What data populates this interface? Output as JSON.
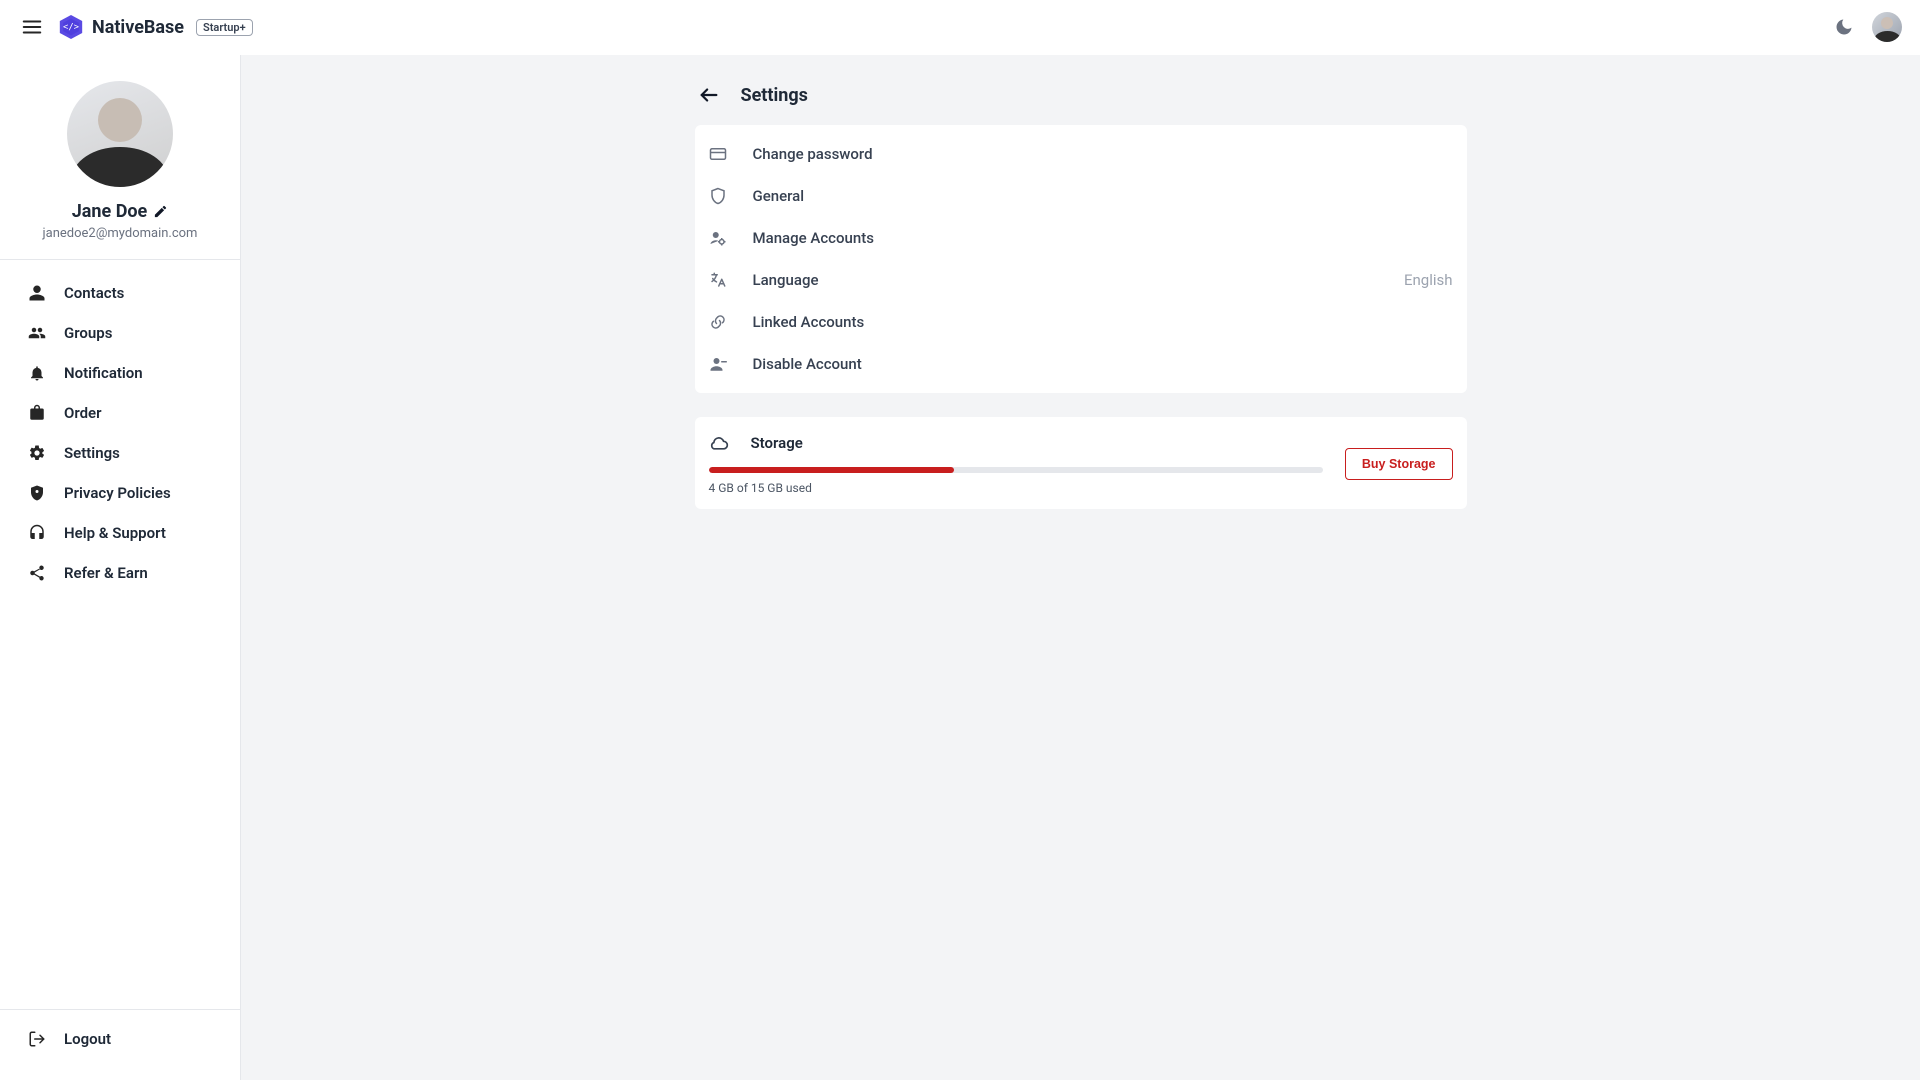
{
  "colors": {
    "accent_red": "#c81e1e"
  },
  "header": {
    "brand_name": "NativeBase",
    "plan_chip": "Startup+"
  },
  "sidebar": {
    "user": {
      "name": "Jane Doe",
      "email": "janedoe2@mydomain.com"
    },
    "items": [
      {
        "label": "Contacts"
      },
      {
        "label": "Groups"
      },
      {
        "label": "Notification"
      },
      {
        "label": "Order"
      },
      {
        "label": "Settings"
      },
      {
        "label": "Privacy Policies"
      },
      {
        "label": "Help & Support"
      },
      {
        "label": "Refer & Earn"
      }
    ],
    "logout_label": "Logout"
  },
  "page": {
    "title": "Settings",
    "rows": [
      {
        "label": "Change password",
        "value": ""
      },
      {
        "label": "General",
        "value": ""
      },
      {
        "label": "Manage Accounts",
        "value": ""
      },
      {
        "label": "Language",
        "value": "English"
      },
      {
        "label": "Linked Accounts",
        "value": ""
      },
      {
        "label": "Disable Account",
        "value": ""
      }
    ],
    "storage": {
      "title": "Storage",
      "usage_text": "4 GB of 15 GB used",
      "progress_percent": 40,
      "buy_label": "Buy Storage"
    }
  }
}
